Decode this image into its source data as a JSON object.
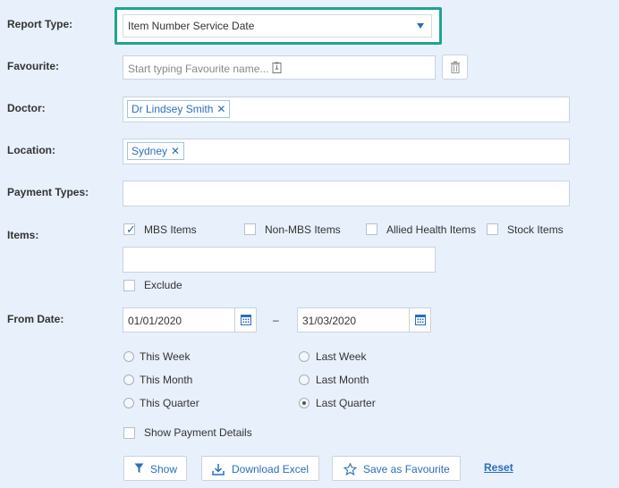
{
  "labels": {
    "report_type": "Report Type:",
    "favourite": "Favourite:",
    "doctor": "Doctor:",
    "location": "Location:",
    "payment_types": "Payment Types:",
    "items": "Items:",
    "from_date": "From Date:"
  },
  "report_type": {
    "selected": "Item Number Service Date"
  },
  "favourite": {
    "placeholder": "Start typing Favourite name..."
  },
  "doctor": {
    "tags": [
      "Dr Lindsey Smith"
    ]
  },
  "location": {
    "tags": [
      "Sydney"
    ]
  },
  "payment_types": {
    "value": ""
  },
  "items": {
    "options": [
      {
        "label": "MBS Items",
        "checked": true
      },
      {
        "label": "Non-MBS Items",
        "checked": false
      },
      {
        "label": "Allied Health Items",
        "checked": false
      },
      {
        "label": "Stock Items",
        "checked": false
      }
    ],
    "input_value": "",
    "exclude_label": "Exclude"
  },
  "dates": {
    "from": "01/01/2020",
    "separator": "–",
    "to": "31/03/2020"
  },
  "ranges": {
    "left": [
      "This Week",
      "This Month",
      "This Quarter"
    ],
    "right": [
      "Last Week",
      "Last Month",
      "Last Quarter"
    ],
    "selected": "Last Quarter"
  },
  "show_payment_details": {
    "label": "Show Payment Details",
    "checked": false
  },
  "buttons": {
    "show": "Show",
    "download_excel": "Download Excel",
    "save_favourite": "Save as Favourite",
    "reset": "Reset"
  },
  "colors": {
    "accent": "#2a6dbd",
    "highlight_border": "#1fa393",
    "background": "#e8f0fb"
  },
  "icons": [
    "chevron-down-icon",
    "clipboard-icon",
    "trash-icon",
    "close-icon",
    "calendar-icon",
    "filter-icon",
    "download-icon",
    "star-icon"
  ]
}
